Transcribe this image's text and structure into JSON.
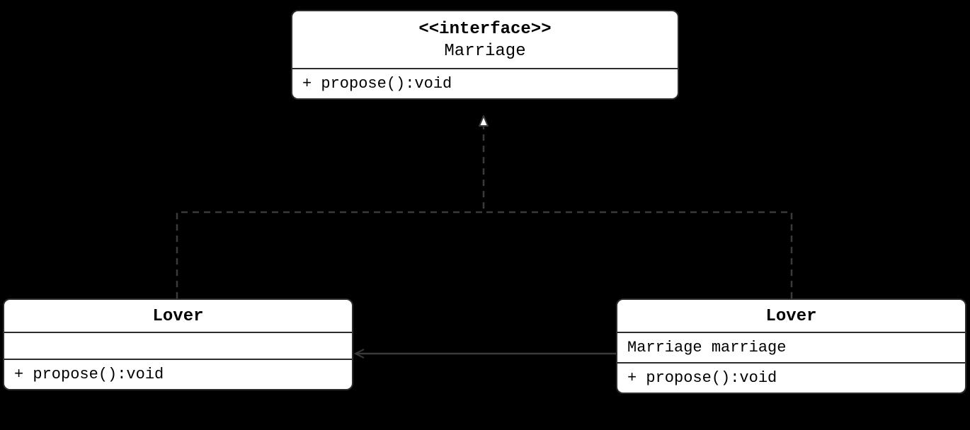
{
  "interface": {
    "stereotype": "<<interface>>",
    "name": "Marriage",
    "method": "+ propose():void"
  },
  "lover_left": {
    "name": "Lover",
    "method": "+ propose():void"
  },
  "lover_right": {
    "name": "Lover",
    "attribute": "Marriage marriage",
    "method": "+ propose():void"
  }
}
